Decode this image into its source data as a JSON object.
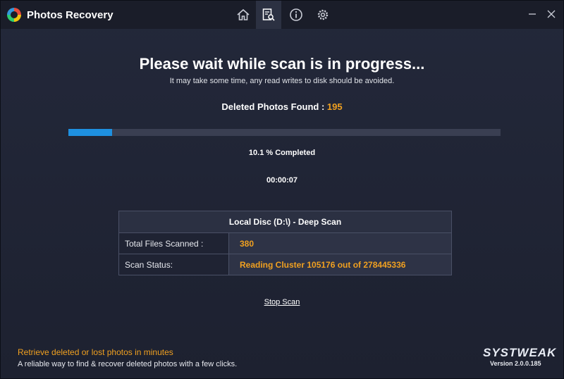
{
  "app": {
    "title": "Photos Recovery"
  },
  "nav": {
    "icons": [
      "home-icon",
      "scan-icon",
      "info-icon",
      "settings-icon"
    ],
    "active": "scan-icon"
  },
  "window_controls": {
    "minimize": "–",
    "close": "✕"
  },
  "scan": {
    "heading": "Please wait while scan is in progress...",
    "subheading": "It may take some time, any read writes to disk should be avoided.",
    "found_label": "Deleted Photos Found : ",
    "found_count": "195",
    "progress_percent": 10.1,
    "percent_text": "10.1 % Completed",
    "elapsed": "00:00:07"
  },
  "details": {
    "title": "Local Disc (D:\\) - Deep Scan",
    "rows": [
      {
        "label": "Total Files Scanned :",
        "value": "380"
      },
      {
        "label": "Scan Status:",
        "value": "Reading Cluster 105176 out of 278445336"
      }
    ]
  },
  "actions": {
    "stop_scan": "Stop Scan"
  },
  "footer": {
    "title": "Retrieve deleted or lost photos in minutes",
    "subtitle": "A reliable way to find & recover deleted photos with a few clicks.",
    "brand": "SYSTWEAK",
    "version": "Version 2.0.0.185"
  },
  "colors": {
    "accent_orange": "#f0a020",
    "progress_blue": "#1e90e0",
    "background": "#1f2333"
  }
}
